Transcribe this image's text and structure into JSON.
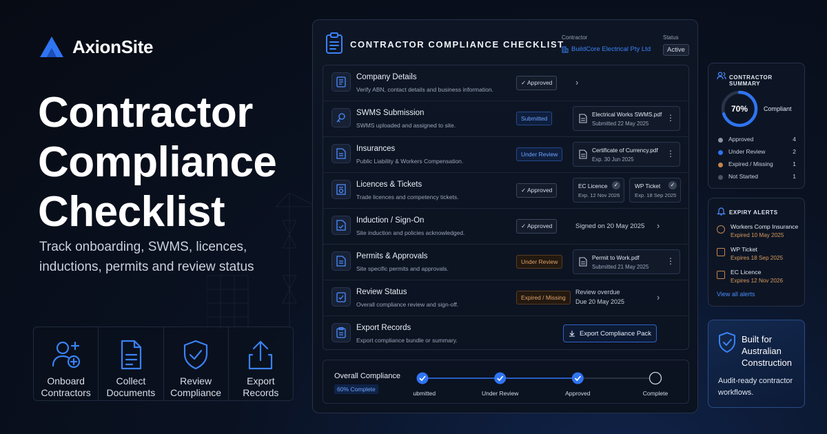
{
  "brand": {
    "name": "AxionSite"
  },
  "hero": {
    "title_lines": [
      "Contractor",
      "Compliance",
      "Checklist"
    ],
    "subtitle": "Track onboarding, SWMS, licences, inductions, permits and review status"
  },
  "features": [
    {
      "label": "Onboard Contractors",
      "icon": "user-add-icon"
    },
    {
      "label": "Collect Documents",
      "icon": "document-icon"
    },
    {
      "label": "Review Compliance",
      "icon": "shield-check-icon"
    },
    {
      "label": "Export Records",
      "icon": "upload-icon"
    }
  ],
  "panel": {
    "title": "CONTRACTOR COMPLIANCE CHECKLIST",
    "contractor_label": "Contractor",
    "contractor_value": "BuildCore Electrical Pty Ltd",
    "status_label": "Status",
    "status_value": "Active",
    "rows": [
      {
        "title": "Company Details",
        "desc": "Verify ABN, contact details and business information.",
        "badge": "✓ Approved"
      },
      {
        "title": "SWMS Submission",
        "desc": "SWMS uploaded and assigned to site.",
        "badge": "Submitted",
        "file": "Electrical Works SWMS.pdf",
        "file_date": "Submitted 22 May 2025"
      },
      {
        "title": "Insurances",
        "desc": "Public Liability & Workers Compensation.",
        "badge": "Under Review",
        "file": "Certificate of Currency.pdf",
        "file_date": "Exp. 30 Jun 2025"
      },
      {
        "title": "Licences & Tickets",
        "desc": "Trade licences and competency tickets.",
        "badge": "✓ Approved",
        "chips": [
          {
            "name": "EC Licence",
            "date": "Exp. 12 Nov 2026"
          },
          {
            "name": "WP Ticket",
            "date": "Exp. 18 Sep 2025"
          }
        ]
      },
      {
        "title": "Induction / Sign-On",
        "desc": "Site induction and policies acknowledged.",
        "badge": "✓ Approved",
        "note": "Signed on 20 May 2025"
      },
      {
        "title": "Permits & Approvals",
        "desc": "Site specific permits and approvals.",
        "badge": "Under Review",
        "file": "Permit to Work.pdf",
        "file_date": "Submitted 21 May 2025"
      },
      {
        "title": "Review Status",
        "desc": "Overall compliance review and sign-off.",
        "badge": "Expired / Missing",
        "note": "Review overdue",
        "note2": "Due 20 May 2025"
      },
      {
        "title": "Export Records",
        "desc": "Export compliance bundle or summary.",
        "button": "Export Compliance Pack"
      }
    ],
    "progress": {
      "label": "Overall Compliance",
      "percent_text": "60% Complete",
      "fraction": 0.6,
      "steps": [
        {
          "label": "Submitted",
          "done": true
        },
        {
          "label": "Under Review",
          "done": true
        },
        {
          "label": "Approved",
          "done": true
        },
        {
          "label": "Complete",
          "done": false
        }
      ]
    }
  },
  "summary": {
    "title": "CONTRACTOR SUMMARY",
    "percent": 70,
    "percent_text": "70%",
    "percent_label": "Compliant",
    "legend": [
      {
        "name": "Approved",
        "count": "4",
        "color": "#8a93a3"
      },
      {
        "name": "Under Review",
        "count": "2",
        "color": "#2f74f2"
      },
      {
        "name": "Expired / Missing",
        "count": "1",
        "color": "#c7854a"
      },
      {
        "name": "Not Started",
        "count": "1",
        "color": "#4b5466"
      }
    ]
  },
  "alerts": {
    "title": "EXPIRY ALERTS",
    "items": [
      {
        "name": "Workers Comp Insurance",
        "date": "Expired 10 May 2025"
      },
      {
        "name": "WP Ticket",
        "date": "Expires 18 Sep 2025"
      },
      {
        "name": "EC Licence",
        "date": "Expires 12 Nov 2026"
      }
    ],
    "view_all": "View all alerts"
  },
  "built": {
    "title": "Built for Australian Construction",
    "subtitle": "Audit-ready contractor workflows."
  },
  "colors": {
    "accent": "#2f74f2",
    "amber": "#d99a5c",
    "background": "#070b14"
  }
}
